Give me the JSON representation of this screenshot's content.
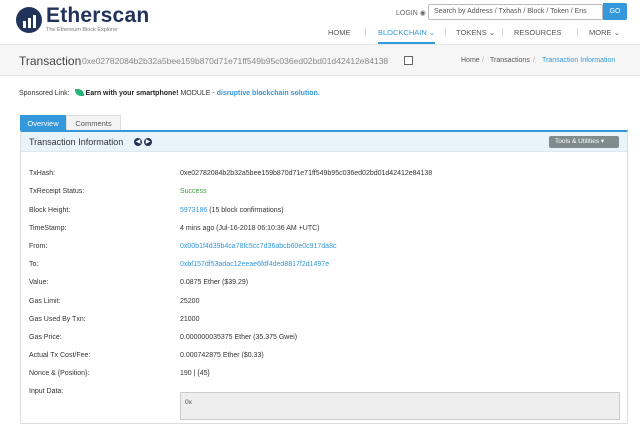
{
  "header": {
    "brand": "Etherscan",
    "tagline": "The Ethereum Block Explorer",
    "login": "LOGIN",
    "search_placeholder": "Search by Address / Txhash / Block / Token / Ens",
    "go_label": "GO",
    "nav": [
      "HOME",
      "BLOCKCHAIN",
      "TOKENS",
      "RESOURCES",
      "MORE"
    ]
  },
  "titlebar": {
    "title": "Transaction",
    "hash": "0xe02782084b2b32a5bee159b870d71e71ff549b95c036ed02bd01d42412e84138",
    "breadcrumb": [
      "Home",
      "Transactions",
      "Transaction Information"
    ]
  },
  "sponsored": {
    "label": "Sponsored Link:",
    "headline": "Earn with your smartphone!",
    "middle": "MODULE -",
    "link": "disruptive blockchain solution."
  },
  "tabs": [
    "Overview",
    "Comments"
  ],
  "panel": {
    "title": "Transaction Information",
    "tools_label": "Tools & Utilities"
  },
  "details": [
    {
      "label": "TxHash:",
      "value": "0xe02782084b2b32a5bee159b870d71e71ff549b95c036ed02bd01d42412e84138"
    },
    {
      "label": "TxReceipt Status:",
      "value": "Success"
    },
    {
      "label": "Block Height:",
      "value": "5973186",
      "suffix": "(15 block confirmations)"
    },
    {
      "label": "TimeStamp:",
      "value": "4 mins ago (Jul-16-2018 06:10:36 AM +UTC)"
    },
    {
      "label": "From:",
      "value": "0x00b1f4d39b4ca78fc5cc7d36abcb60e0c917da8c"
    },
    {
      "label": "To:",
      "value": "0xbf157df53adac12eeae6fdf4ded8817f2d1497e"
    },
    {
      "label": "Value:",
      "value": "0.0875 Ether ($39.29)"
    },
    {
      "label": "Gas Limit:",
      "value": "25200"
    },
    {
      "label": "Gas Used By Txn:",
      "value": "21000"
    },
    {
      "label": "Gas Price:",
      "value": "0.000000035375 Ether (35.375 Gwei)"
    },
    {
      "label": "Actual Tx Cost/Fee:",
      "value": "0.000742875 Ether ($0.33)"
    },
    {
      "label": "Nonce & {Position}:",
      "value": "190 | {45}"
    },
    {
      "label": "Input Data:",
      "value": "0x"
    }
  ],
  "colors": {
    "accent": "#3498db",
    "brand": "#21325b",
    "success": "#3c9a3c"
  }
}
